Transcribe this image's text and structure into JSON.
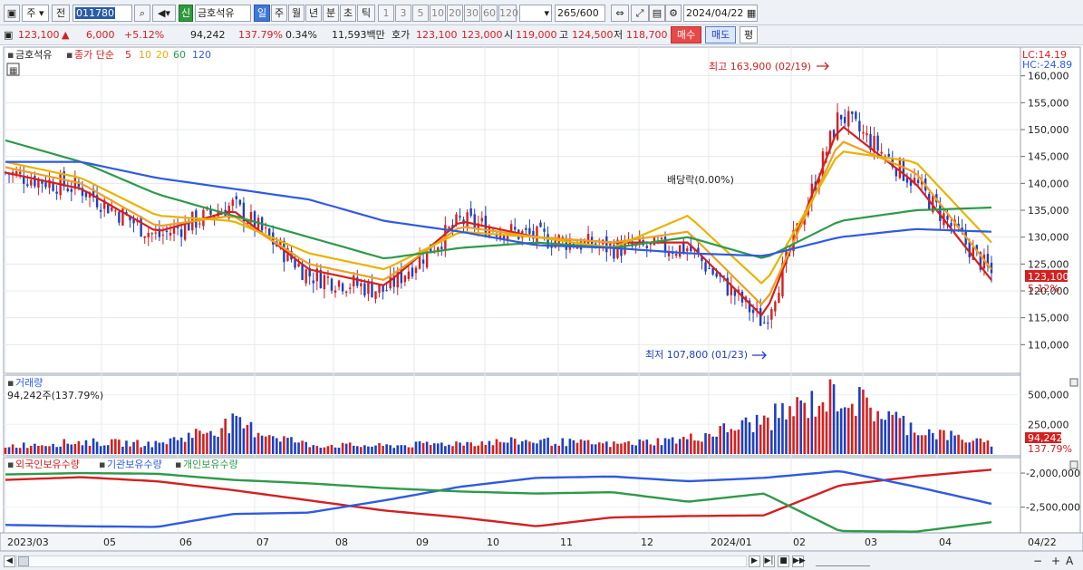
{
  "toolbar": {
    "market_type": "주",
    "prev_label": "전",
    "code_value": "011780",
    "new_badge": "신",
    "stock_name": "금호석유",
    "period_day": "일",
    "period_week": "주",
    "period_month": "월",
    "period_year": "년",
    "period_minute": "분",
    "period_second": "초",
    "period_tick": "틱",
    "intervals": [
      "1",
      "3",
      "5",
      "10",
      "20",
      "30",
      "60",
      "120"
    ],
    "count_value": "265",
    "count_total": "/600",
    "date_value": "2024/04/22"
  },
  "info": {
    "price": "123,100",
    "change": "6,000",
    "change_pct": "+5.12%",
    "volume": "94,242",
    "vol_ratio": "137.79%",
    "turnover_pct": "0.34%",
    "amount": "11,593백만",
    "ask_label": "호가",
    "ask": "123,100",
    "bid": "123,000",
    "open_label": "시",
    "open": "119,000",
    "high_label": "고",
    "high": "124,500",
    "low_label": "저",
    "low": "118,700",
    "buy_button": "매수",
    "sell_button": "매도",
    "eval_button": "평"
  },
  "price_panel": {
    "name": "금호석유",
    "ma_label": "종가 단순",
    "ma_periods": [
      "5",
      "10",
      "20",
      "60",
      "120"
    ],
    "lc_label": "LC:14.19",
    "hc_label": "HC:-24.89",
    "max_label": "최고 163,900 (02/19)",
    "min_label": "최저 107,800 (01/23)",
    "dividend_label": "배당락(0.00%)",
    "last_price_tag": "123,100",
    "last_pct_tag": "5.12%"
  },
  "volume_panel": {
    "title": "거래량",
    "value_label": "94,242주(137.79%)",
    "last_tag": "94,242",
    "last_pct_tag": "137.79%"
  },
  "holdings_panel": {
    "legend": [
      "외국인보유수량",
      "기관보유수량",
      "개인보유수량"
    ]
  },
  "x_axis_labels": [
    "2023/03",
    "05",
    "06",
    "07",
    "08",
    "09",
    "10",
    "11",
    "12",
    "2024/01",
    "02",
    "03",
    "04"
  ],
  "right_date": "04/22",
  "chart_data": [
    {
      "type": "line",
      "title": "금호석유",
      "ylim": [
        105000,
        165000
      ],
      "yticks": [
        110000,
        115000,
        120000,
        125000,
        130000,
        135000,
        140000,
        145000,
        150000,
        155000,
        160000
      ],
      "ytick_labels": [
        "110,000",
        "115,000",
        "120,000",
        "125,000",
        "130,000",
        "135,000",
        "140,000",
        "145,000",
        "150,000",
        "155,000",
        "160,000"
      ],
      "x": [
        "2023/03",
        "05",
        "06",
        "07",
        "08",
        "09",
        "10",
        "11",
        "12",
        "2024/01",
        "02",
        "03",
        "04",
        "04/22"
      ],
      "series": [
        {
          "name": "종가",
          "values": [
            142000,
            139000,
            130000,
            136000,
            123000,
            120000,
            133000,
            130000,
            128000,
            128000,
            114000,
            153000,
            140000,
            123100
          ]
        },
        {
          "name": "5",
          "values": [
            142000,
            139000,
            131000,
            135000,
            124000,
            121000,
            133000,
            130000,
            129000,
            129000,
            115000,
            151000,
            140000,
            122000
          ]
        },
        {
          "name": "10",
          "values": [
            143000,
            140000,
            132000,
            134000,
            125000,
            122000,
            132000,
            130000,
            129000,
            131000,
            117000,
            148000,
            142000,
            124000
          ]
        },
        {
          "name": "20",
          "values": [
            144000,
            141000,
            134000,
            133000,
            127000,
            124000,
            131000,
            130000,
            128000,
            134000,
            121000,
            146000,
            144000,
            129000
          ]
        },
        {
          "name": "60",
          "values": [
            148000,
            144000,
            138000,
            134000,
            130000,
            126000,
            128000,
            129000,
            128000,
            130000,
            126000,
            133000,
            135000,
            135500
          ]
        },
        {
          "name": "120",
          "values": [
            144000,
            144000,
            141000,
            139000,
            137000,
            133000,
            131000,
            128500,
            128000,
            127000,
            126500,
            130000,
            131500,
            131000
          ]
        }
      ],
      "colors": {
        "close": "#d42020",
        "5": "#d42020",
        "10": "#f0a020",
        "20": "#e8b400",
        "60": "#2e9a4a",
        "120": "#2f5be0"
      }
    },
    {
      "type": "bar",
      "title": "거래량",
      "ylim": [
        0,
        650000
      ],
      "yticks": [
        250000,
        500000
      ],
      "ytick_labels": [
        "250,000",
        "500,000"
      ],
      "x": [
        "2023/03",
        "05",
        "06",
        "07",
        "08",
        "09",
        "10",
        "11",
        "12",
        "2024/01",
        "02",
        "03",
        "04",
        "04/22"
      ],
      "values": [
        80000,
        120000,
        100000,
        300000,
        90000,
        80000,
        110000,
        130000,
        95000,
        150000,
        330000,
        600000,
        250000,
        94242
      ],
      "last_value": 94242,
      "last_ratio": "137.79%"
    },
    {
      "type": "line",
      "title": "외국인보유수량 / 기관보유수량 / 개인보유수량",
      "ylim": [
        -2850000,
        -1800000
      ],
      "yticks": [
        -2500000,
        -2000000
      ],
      "ytick_labels": [
        "-2,500,000",
        "-2,000,000"
      ],
      "x": [
        "2023/03",
        "05",
        "06",
        "07",
        "08",
        "09",
        "10",
        "11",
        "12",
        "2024/01",
        "02",
        "03",
        "04",
        "04/22"
      ],
      "series": [
        {
          "name": "외국인보유수량",
          "values": [
            -2100000,
            -2060000,
            -2120000,
            -2250000,
            -2400000,
            -2550000,
            -2650000,
            -2780000,
            -2650000,
            -2630000,
            -2620000,
            -2180000,
            -2050000,
            -1950000
          ]
        },
        {
          "name": "기관보유수량",
          "values": [
            -2760000,
            -2780000,
            -2790000,
            -2600000,
            -2580000,
            -2400000,
            -2200000,
            -2070000,
            -2050000,
            -2120000,
            -2070000,
            -1970000,
            -2200000,
            -2450000
          ]
        },
        {
          "name": "개인보유수량",
          "values": [
            -2020000,
            -2000000,
            -2010000,
            -2100000,
            -2150000,
            -2220000,
            -2270000,
            -2300000,
            -2280000,
            -2420000,
            -2300000,
            -2850000,
            -2860000,
            -2720000
          ]
        }
      ],
      "colors": {
        "외국인보유수량": "#d42020",
        "기관보유수량": "#2f5be0",
        "개인보유수량": "#2e9a4a"
      }
    }
  ]
}
